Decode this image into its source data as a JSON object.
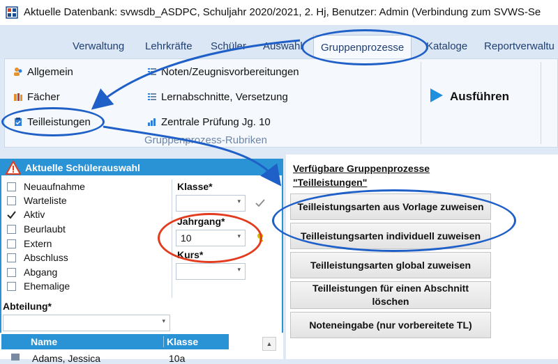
{
  "window": {
    "title": "Aktuelle Datenbank: svwsdb_ASDPC, Schuljahr 2020/2021, 2. Hj, Benutzer: Admin (Verbindung zum SVWS-Se"
  },
  "menu": {
    "tabs": [
      "Verwaltung",
      "Lehrkräfte",
      "Schüler",
      "Auswahl",
      "Gruppenprozesse",
      "Kataloge",
      "Reportverwaltu"
    ],
    "active": "Gruppenprozesse"
  },
  "ribbon": {
    "col1": [
      "Allgemein",
      "Fächer",
      "Teilleistungen"
    ],
    "col2": [
      "Noten/Zeugnisvorbereitungen",
      "Lernabschnitte, Versetzung",
      "Zentrale Prüfung Jg. 10"
    ],
    "group_label": "Gruppenprozess-Rubriken",
    "run_label": "Ausführen"
  },
  "selection": {
    "title": "Aktuelle Schülerauswahl",
    "status_items": [
      {
        "label": "Neuaufnahme",
        "checked": false
      },
      {
        "label": "Warteliste",
        "checked": false
      },
      {
        "label": "Aktiv",
        "checked": true
      },
      {
        "label": "Beurlaubt",
        "checked": false
      },
      {
        "label": "Extern",
        "checked": false
      },
      {
        "label": "Abschluss",
        "checked": false
      },
      {
        "label": "Abgang",
        "checked": false
      },
      {
        "label": "Ehemalige",
        "checked": false
      }
    ],
    "klasse_label": "Klasse*",
    "klasse_value": "",
    "jahrgang_label": "Jahrgang*",
    "jahrgang_value": "10",
    "kurs_label": "Kurs*",
    "kurs_value": "",
    "abteilung_label": "Abteilung*",
    "abteilung_value": ""
  },
  "table": {
    "headers": [
      "Name",
      "Klasse"
    ],
    "rows": [
      {
        "name": "Adams, Jessica",
        "klasse": "10a"
      }
    ]
  },
  "processes": {
    "heading_line1": "Verfügbare Gruppenprozesse",
    "heading_line2": "\"Teilleistungen\"",
    "buttons": [
      "Teilleistungsarten aus Vorlage zuweisen",
      "Teilleistungsarten individuell zuweisen",
      "Teilleistungsarten global zuweisen",
      "Teilleistungen für einen Abschnitt löschen",
      "Noteneingabe (nur vorbereitete TL)"
    ]
  },
  "colors": {
    "accent": "#2a93d5",
    "annotation": "#1f5fc8",
    "highlight": "#e23b1e"
  }
}
